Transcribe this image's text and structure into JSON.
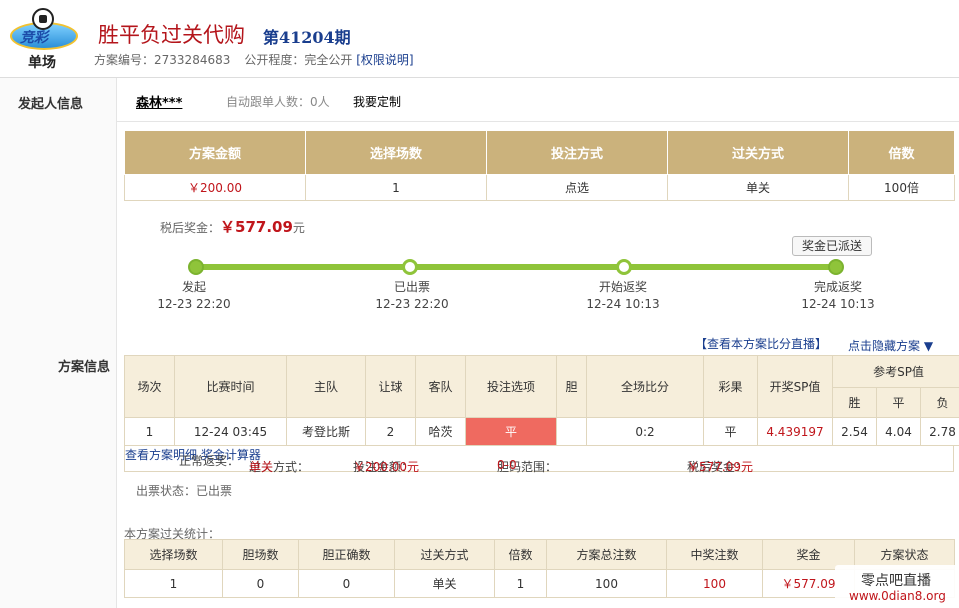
{
  "header": {
    "logo_text": "单场",
    "title": "胜平负过关代购",
    "issue": "第41204期",
    "plan_no_label": "方案编号：",
    "plan_no": "2733284683",
    "visibility_label": "公开程度：",
    "visibility": "完全公开",
    "permission_link": "[权限说明]"
  },
  "starter": {
    "section_label": "发起人信息",
    "name": "森林***",
    "follow_label": "自动跟单人数：0人",
    "custom_label": "我要定制"
  },
  "plan_section_label": "方案信息",
  "overview": {
    "headers": [
      "方案金额",
      "选择场数",
      "投注方式",
      "过关方式",
      "倍数"
    ],
    "values": [
      "￥200.00",
      "1",
      "点选",
      "单关",
      "100倍"
    ]
  },
  "prize": {
    "label": "税后奖金：",
    "amount": "￥577.09",
    "unit": "元"
  },
  "progress": {
    "badge": "奖金已派送",
    "steps": [
      {
        "name": "发起",
        "time": "12-23 22:20"
      },
      {
        "name": "已出票",
        "time": "12-23 22:20"
      },
      {
        "name": "开始返奖",
        "time": "12-24 10:13"
      },
      {
        "name": "完成返奖",
        "time": "12-24 10:13"
      }
    ]
  },
  "links": {
    "live": "【查看本方案比分直播】",
    "hide": "点击隐藏方案 ▼"
  },
  "match_table": {
    "headers": [
      "场次",
      "比赛时间",
      "主队",
      "让球",
      "客队",
      "投注选项",
      "胆",
      "全场比分",
      "彩果",
      "开奖SP值",
      "参考SP值"
    ],
    "sp_sub": [
      "胜",
      "平",
      "负"
    ],
    "row": {
      "no": "1",
      "time": "12-24 03:45",
      "home": "考登比斯",
      "handicap": "2",
      "away": "哈茨",
      "pick": "平",
      "banker": "",
      "score": "0:2",
      "result": "平",
      "sp": "4.439197",
      "ref_win": "2.54",
      "ref_draw": "4.04",
      "ref_lose": "2.78"
    }
  },
  "summary": {
    "return_label": "正常返奖：",
    "pass_label": "过关方式：",
    "pass_value": "单关",
    "bet_label": "投注金额：",
    "bet_value": "￥200.00元",
    "banker_label": "胆码范围：",
    "banker_value": "0-0",
    "detail_link": "查看方案明细",
    "prize_label": "税后奖金：",
    "prize_value": "￥577.09元",
    "calc_link": "奖金计算器"
  },
  "ticket_status": "出票状态：已出票",
  "stats": {
    "title": "本方案过关统计：",
    "headers": [
      "选择场数",
      "胆场数",
      "胆正确数",
      "过关方式",
      "倍数",
      "方案总注数",
      "中奖注数",
      "奖金",
      "方案状态"
    ],
    "values": [
      "1",
      "0",
      "0",
      "单关",
      "1",
      "100",
      "100",
      "￥577.09",
      ""
    ]
  },
  "watermark": {
    "line1": "零点吧直播",
    "line2": "www.0dian8.org"
  }
}
